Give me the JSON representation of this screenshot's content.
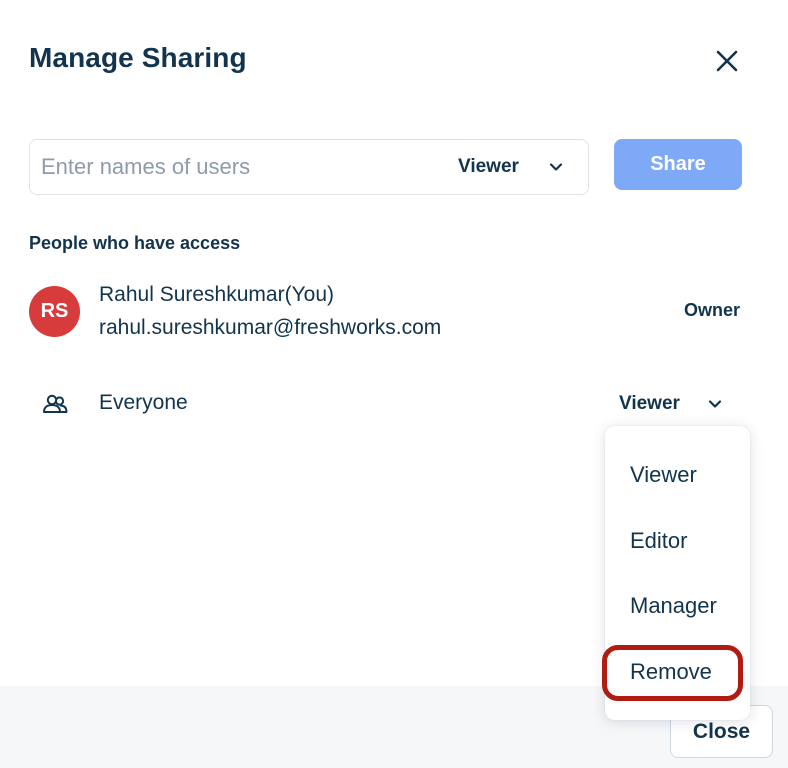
{
  "dialog": {
    "title": "Manage Sharing",
    "close_icon": "close-icon"
  },
  "share": {
    "input_placeholder": "Enter names of users",
    "input_value": "",
    "role_selected": "Viewer",
    "role_icon": "chevron-down-icon",
    "share_button_label": "Share",
    "share_button_color": "#7ea9f7"
  },
  "access": {
    "section_label": "People who have access",
    "people": [
      {
        "initials": "RS",
        "name": "Rahul Sureshkumar(You)",
        "email": "rahul.sureshkumar@freshworks.com",
        "role": "Owner",
        "avatar_color": "#d83b3b"
      }
    ],
    "everyone": {
      "icon": "group-icon",
      "label": "Everyone",
      "role": "Viewer",
      "role_icon": "chevron-down-icon"
    }
  },
  "role_menu": {
    "items": [
      "Viewer",
      "Editor",
      "Manager",
      "Remove"
    ],
    "highlighted_item": "Remove",
    "highlight_color": "#b01c12"
  },
  "footer": {
    "close_button_label": "Close"
  }
}
